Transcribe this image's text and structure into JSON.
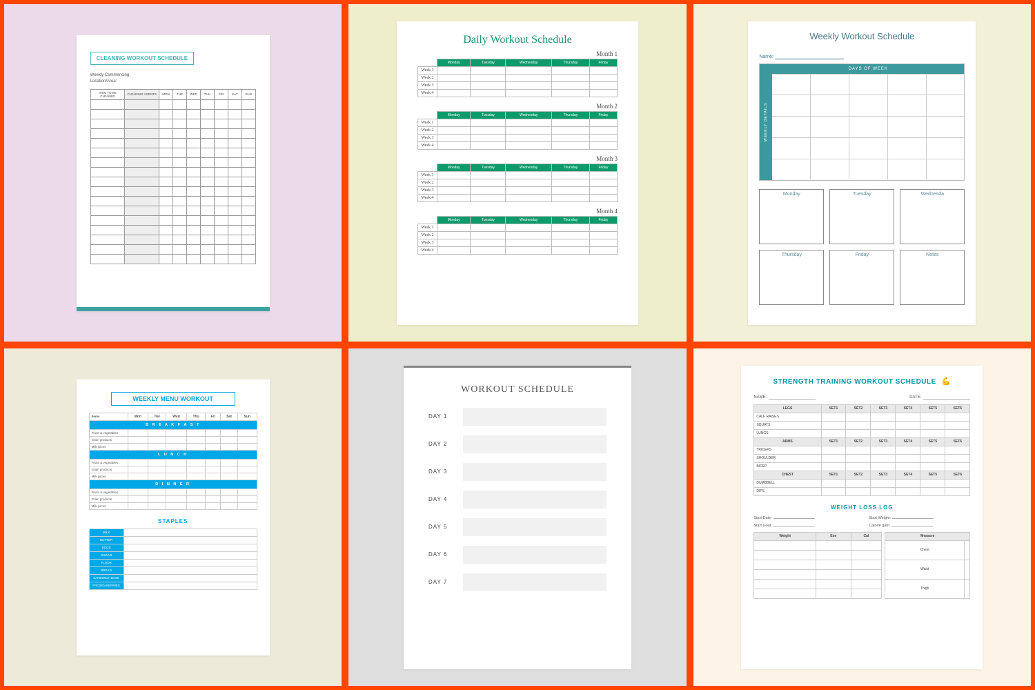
{
  "grid": {
    "c1": {
      "title": "CLEANING WORKOUT SCHEDULE",
      "meta1": "Weekly Commencing:",
      "meta2": "Location/Area:",
      "th_item": "ITEM TO BE CLEANED",
      "th_agents": "CLEANING AGENTS",
      "days": [
        "MON",
        "TUE",
        "WED",
        "THU",
        "FRI",
        "SAT",
        "SUN"
      ]
    },
    "c2": {
      "title": "Daily Workout Schedule",
      "months": [
        "Month 1",
        "Month 2",
        "Month 3",
        "Month 4"
      ],
      "days": [
        "Monday",
        "Tuesday",
        "Wednesday",
        "Thursday",
        "Friday"
      ],
      "weeks": [
        "Week 1",
        "Week 2",
        "Week 3",
        "Week 4"
      ]
    },
    "c3": {
      "title": "Weekly Workout Schedule",
      "name_label": "Name:",
      "toprow": "DAYS OF WEEK",
      "side": "WEEKLY DETAILS",
      "boxes": [
        "Monday",
        "Tuesday",
        "Wednesda",
        "Thursday",
        "Friday",
        "Notes"
      ]
    },
    "c4": {
      "title": "WEEKLY MENU WORKOUT",
      "th_items": "Items",
      "days": [
        "Mon",
        "Tue",
        "Wed",
        "Thu",
        "Fri",
        "Sat",
        "Sun"
      ],
      "meals": [
        "B R E A K F A S T",
        "L U N C H",
        "D I N N E R"
      ],
      "rows": [
        "Fruits & vegetables",
        "Grain products",
        "Milk juices"
      ],
      "staples_title": "STAPLES",
      "staples": [
        "MILK",
        "BUTTER",
        "EGGS",
        "SUGAR",
        "FLOUR",
        "BREAD",
        "SANDWICH BASE",
        "FROZEN BERRIES"
      ]
    },
    "c5": {
      "title": "WORKOUT SCHEDULE",
      "days": [
        "DAY 1",
        "DAY 2",
        "DAY 3",
        "DAY 4",
        "DAY 5",
        "DAY 6",
        "DAY 7"
      ]
    },
    "c6": {
      "title": "STRENGTH TRAINING WORKOUT SCHEDULE",
      "name": "NAME:",
      "date": "DATE:",
      "sets": [
        "SET1",
        "SET2",
        "SET3",
        "SET4",
        "SET5",
        "SET6"
      ],
      "groups": [
        {
          "name": "LEGS",
          "rows": [
            "CALF RAISES",
            "SQUATS",
            "LUNGS"
          ]
        },
        {
          "name": "ARMS",
          "rows": [
            "TRICEPS",
            "SHOULDER",
            "BICEP"
          ]
        },
        {
          "name": "CHEST",
          "rows": [
            "DUMBBELL",
            "DIPS"
          ]
        }
      ],
      "log_title": "WEIGHT LOSS LOG",
      "log_meta": {
        "sd": "Start Date:",
        "sg": "Start Goal:",
        "sw": "Start Weight:",
        "cg": "Calorie gain:"
      },
      "log_cols": [
        "Weight",
        "Exe",
        "Cal"
      ],
      "measure": "Measure",
      "body": [
        "Chest",
        "Waist",
        "Thigh"
      ]
    }
  }
}
